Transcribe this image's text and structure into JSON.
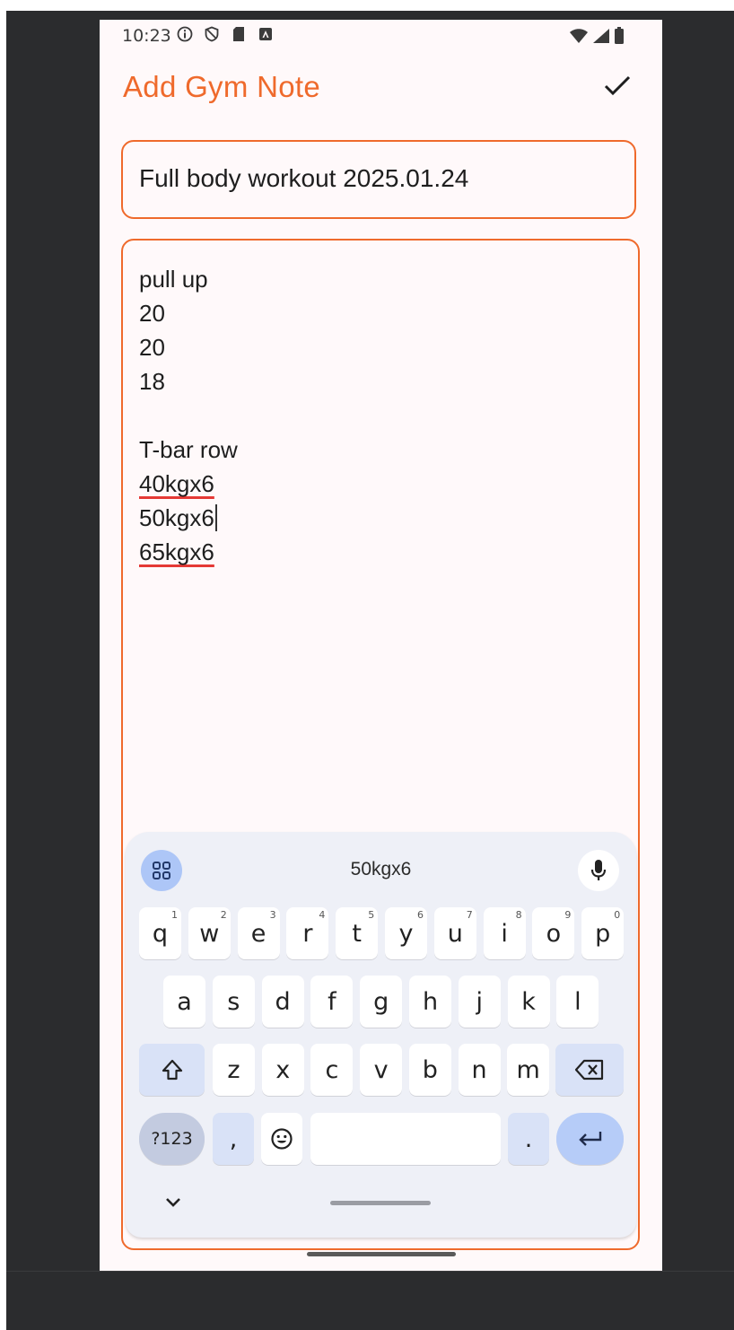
{
  "status_bar": {
    "time": "10:23",
    "left_icons": [
      "info-icon",
      "shield-icon",
      "sd-card-icon",
      "app-icon"
    ],
    "right_icons": [
      "wifi-icon",
      "signal-icon",
      "battery-icon"
    ]
  },
  "app_bar": {
    "title": "Add Gym Note",
    "action_icon": "check-icon"
  },
  "note": {
    "title_value": "Full body workout 2025.01.24",
    "body_lines": [
      {
        "text": "pull up",
        "misspelled": false,
        "caret": false
      },
      {
        "text": "20",
        "misspelled": false,
        "caret": false
      },
      {
        "text": "20",
        "misspelled": false,
        "caret": false
      },
      {
        "text": "18",
        "misspelled": false,
        "caret": false
      },
      {
        "text": "",
        "misspelled": false,
        "caret": false
      },
      {
        "text": "T-bar row",
        "misspelled": false,
        "caret": false
      },
      {
        "text": "40kgx6",
        "misspelled": true,
        "caret": false
      },
      {
        "text": "50kgx6",
        "misspelled": false,
        "caret": true
      },
      {
        "text": "65kgx6",
        "misspelled": true,
        "caret": false
      }
    ]
  },
  "keyboard": {
    "suggestion": "50kgx6",
    "row1": [
      {
        "label": "q",
        "hint": "1"
      },
      {
        "label": "w",
        "hint": "2"
      },
      {
        "label": "e",
        "hint": "3"
      },
      {
        "label": "r",
        "hint": "4"
      },
      {
        "label": "t",
        "hint": "5"
      },
      {
        "label": "y",
        "hint": "6"
      },
      {
        "label": "u",
        "hint": "7"
      },
      {
        "label": "i",
        "hint": "8"
      },
      {
        "label": "o",
        "hint": "9"
      },
      {
        "label": "p",
        "hint": "0"
      }
    ],
    "row2": [
      "a",
      "s",
      "d",
      "f",
      "g",
      "h",
      "j",
      "k",
      "l"
    ],
    "row3": [
      "z",
      "x",
      "c",
      "v",
      "b",
      "n",
      "m"
    ],
    "symbols_label": "?123",
    "comma_label": ",",
    "period_label": ".",
    "colors": {
      "accent": "#ef6a2c",
      "key_bg": "#ffffff",
      "keyboard_bg": "#eef0f7",
      "enter_bg": "#b6ccf8"
    }
  }
}
